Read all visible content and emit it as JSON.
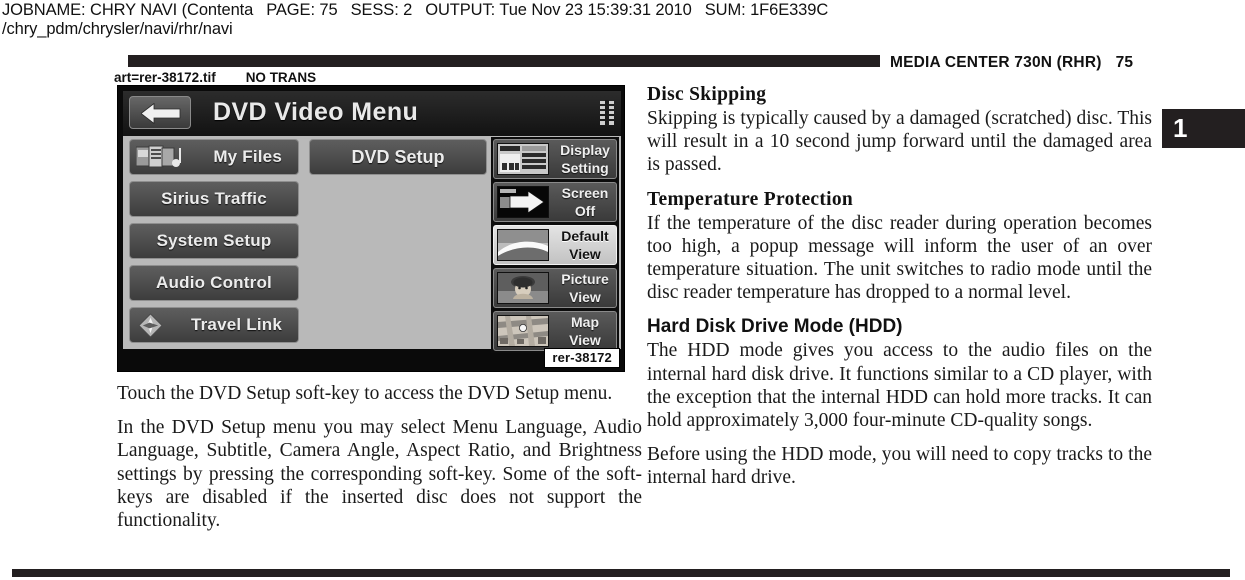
{
  "job": {
    "jobname_label": "JOBNAME:",
    "jobname_value": "CHRY NAVI (Contenta",
    "page_label": "PAGE:",
    "page_value": "75",
    "sess_label": "SESS:",
    "sess_value": "2",
    "output_label": "OUTPUT:",
    "output_value": "Tue Nov 23 15:39:31 2010",
    "sum_label": "SUM:",
    "sum_value": "1F6E339C",
    "path": "/chry_pdm/chrysler/navi/rhr/navi"
  },
  "running_head": {
    "title": "MEDIA CENTER 730N (RHR)",
    "page_number": "75"
  },
  "art_slug": {
    "art": "art=rer-38172.tif",
    "trans": "NO TRANS"
  },
  "thumb_tab": {
    "label": "1"
  },
  "figure": {
    "caption_chip": "rer-38172",
    "screen": {
      "title": "DVD Video Menu",
      "back_icon": "back-arrow-icon",
      "header_icon": "list-menu-icon",
      "left_softkeys": [
        {
          "label": "My Files",
          "icon": "my-files-media-icon",
          "has_icon": true
        },
        {
          "label": "Sirius Traffic",
          "icon": "",
          "has_icon": false
        },
        {
          "label": "System Setup",
          "icon": "",
          "has_icon": false
        },
        {
          "label": "Audio Control",
          "icon": "",
          "has_icon": false
        },
        {
          "label": "Travel Link",
          "icon": "travel-link-compass-icon",
          "has_icon": true
        }
      ],
      "center_softkey": {
        "label": "DVD Setup"
      },
      "view_softkeys": [
        {
          "line1": "Display",
          "line2": "Setting",
          "icon": "display-setting-icon",
          "selected": false
        },
        {
          "line1": "Screen",
          "line2": "Off",
          "icon": "screen-off-icon",
          "selected": false
        },
        {
          "line1": "Default",
          "line2": "View",
          "icon": "default-view-icon",
          "selected": true
        },
        {
          "line1": "Picture",
          "line2": "View",
          "icon": "picture-view-icon",
          "selected": false
        },
        {
          "line1": "Map",
          "line2": "View",
          "icon": "map-view-icon",
          "selected": false
        }
      ]
    }
  },
  "left_column": {
    "paragraphs": [
      "Touch the DVD Setup soft-key to access the DVD Setup menu.",
      "In the DVD Setup menu you may select Menu Language, Audio Language, Subtitle, Camera Angle, Aspect Ratio, and Brightness settings by pressing the corresponding soft-key. Some of the soft-keys are disabled if the inserted disc does not support the functionality."
    ]
  },
  "right_column": {
    "sections": [
      {
        "heading": "Disc Skipping",
        "heading_style": "serif",
        "paragraphs": [
          "Skipping is typically caused by a damaged (scratched) disc. This will result in a 10 second jump forward until the damaged area is passed."
        ]
      },
      {
        "heading": "Temperature Protection",
        "heading_style": "serif",
        "paragraphs": [
          "If the temperature of the disc reader during operation becomes too high, a popup message will inform the user of an over temperature situation. The unit switches to radio mode until the disc reader temperature has dropped to a normal level."
        ]
      },
      {
        "heading": "Hard Disk Drive Mode (HDD)",
        "heading_style": "sans",
        "paragraphs": [
          "The HDD mode gives you access to the audio files on the internal hard disk drive. It functions similar to a CD player, with the exception that the internal HDD can hold more tracks. It can hold approximately 3,000 four-minute CD-quality songs.",
          "Before using the HDD mode, you will need to copy tracks to the internal hard drive."
        ]
      }
    ]
  }
}
